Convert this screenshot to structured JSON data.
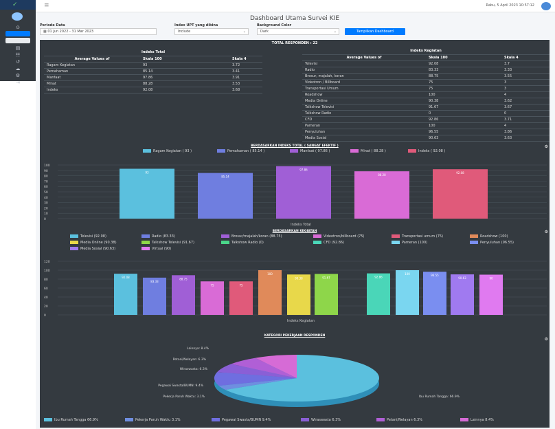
{
  "header": {
    "datetime": "Rabu, 5 April 2023 10:57:12"
  },
  "title": "Dashboard Utama Survei KIE",
  "filters": {
    "periode_label": "Periode Data",
    "periode_value": "01 Jun 2022 - 31 Mar 2023",
    "upt_label": "Index UPT yang dibina",
    "upt_value": "Include",
    "bg_label": "Background Color",
    "bg_value": "Dark",
    "show_button": "Tampilkan Dashboard"
  },
  "total_responden": "TOTAL RESPONDEN : 22",
  "indeks_total": {
    "title": "Indeks Total",
    "headers": [
      "Average Values of",
      "Skala 100",
      "Skala 4"
    ],
    "rows": [
      [
        "Ragam Kegiatan",
        "93",
        "3.72"
      ],
      [
        "Pemahaman",
        "85.14",
        "3.41"
      ],
      [
        "Manfaat",
        "97.86",
        "3.91"
      ],
      [
        "Minat",
        "88.28",
        "3.53"
      ],
      [
        "Indeks",
        "92.08",
        "3.68"
      ]
    ]
  },
  "indeks_kegiatan": {
    "title": "Indeks Kegiatan",
    "headers": [
      "Average Values of",
      "Skala 100",
      "Skala 4"
    ],
    "rows": [
      [
        "Televisi",
        "92.08",
        "3.7"
      ],
      [
        "Radio",
        "83.33",
        "3.33"
      ],
      [
        "Brosur, majalah, koran",
        "88.75",
        "3.55"
      ],
      [
        "Videotron / Billboard",
        "75",
        "3"
      ],
      [
        "Transportasi Umum",
        "75",
        "3"
      ],
      [
        "Roadshow",
        "100",
        "4"
      ],
      [
        "Media Online",
        "90.38",
        "3.62"
      ],
      [
        "Talkshow Televisi",
        "91.67",
        "3.67"
      ],
      [
        "Talkshow Radio",
        "0",
        "0"
      ],
      [
        "CFD",
        "92.86",
        "3.71"
      ],
      [
        "Pameran",
        "100",
        "4"
      ],
      [
        "Penyuluhan",
        "96.55",
        "3.86"
      ],
      [
        "Media Sosial",
        "90.63",
        "3.63"
      ],
      [
        "Virtual",
        "90",
        "3.6"
      ]
    ]
  },
  "chart_total": {
    "title": "BERDASARKAN INDEKS TOTAL ( SANGAT EFEKTIF )",
    "xlabel": "Indeks Total",
    "chart_data": {
      "type": "bar",
      "categories": [
        "Ragam Kegiatan",
        "Pemahaman",
        "Manfaat",
        "Minat",
        "Indeks"
      ],
      "values": [
        93,
        85.14,
        97.86,
        88.28,
        92.08
      ],
      "legend": [
        "Ragam Kegiatan ( 93 )",
        "Pemahaman ( 85.14 )",
        "Manfaat ( 97.86 )",
        "Minat ( 88.28 )",
        "Indeks ( 92.08 )"
      ],
      "colors": [
        "#5bc0de",
        "#6f7ee0",
        "#a05fd6",
        "#d96bd6",
        "#e05a7a"
      ],
      "ylim": [
        0,
        100
      ],
      "yticks": [
        0,
        10,
        20,
        30,
        40,
        50,
        60,
        70,
        80,
        90,
        100
      ]
    }
  },
  "chart_kegiatan": {
    "title": "BERDASARKAN KEGIATAN",
    "xlabel": "Indeks Kegiatan",
    "chart_data": {
      "type": "bar",
      "categories": [
        "Televisi",
        "Radio",
        "Brosur/majalah/koran",
        "Videotron/billboard",
        "Transportasi umum",
        "Roadshow",
        "Media Online",
        "Talkshow Televisi",
        "Talkshow Radio",
        "CFD",
        "Pameran",
        "Penyuluhan",
        "Media Sosial",
        "Virtual"
      ],
      "values": [
        92.08,
        83.33,
        88.75,
        75,
        75,
        100,
        90.38,
        91.67,
        0,
        92.86,
        100,
        96.55,
        90.63,
        90
      ],
      "labels": [
        "92.08",
        "83.33",
        "88.75",
        "75",
        "75",
        "100",
        "90.38",
        "91.67",
        "",
        "92.86",
        "100",
        "96.55",
        "90.63",
        "90"
      ],
      "legend": [
        "Televisi (92.08)",
        "Radio (83.33)",
        "Brosur/majalah/koran (88.75)",
        "Videotron/billboard (75)",
        "Transportasi umum (75)",
        "Roadshow (100)",
        "Media Online (90.38)",
        "Talkshow Televisi (91.67)",
        "Talkshow Radio (0)",
        "CFD (92.86)",
        "Pameran (100)",
        "Penyuluhan (96.55)",
        "Media Sosial (90.63)",
        "Virtual (90)"
      ],
      "colors": [
        "#5bc0de",
        "#6f7ee0",
        "#a05fd6",
        "#d96bd6",
        "#e05a7a",
        "#e08a5a",
        "#e8d84a",
        "#8ed64a",
        "#4ad68a",
        "#4ad6b8",
        "#7ad6f0",
        "#7a8ef0",
        "#a07af0",
        "#e07af0"
      ],
      "ylim": [
        0,
        120
      ],
      "yticks": [
        0,
        20,
        40,
        60,
        80,
        100,
        120
      ]
    }
  },
  "chart_pekerjaan": {
    "title": "KATEGORI PEKERJAAN RESPONDEN",
    "chart_data": {
      "type": "pie",
      "categories": [
        "Ibu Rumah Tangga",
        "Pekerja Paruh Waktu",
        "Pegawai Swasta/BUMN",
        "Wiraswasta",
        "Petani/Nelayan",
        "Lainnya"
      ],
      "values": [
        66.9,
        3.1,
        9.4,
        6.3,
        6.3,
        8.4
      ],
      "labels": [
        "Ibu Rumah Tangga: 66.9%",
        "Pekerja Paruh Waktu: 3.1%",
        "Pegawai Swasta/BUMN: 9.4%",
        "Wiraswasta: 6.3%",
        "Petani/Nelayan: 6.3%",
        "Lainnya: 8.4%"
      ],
      "legend_names": [
        "Ibu Rumah Tangga",
        "Pekerja Paruh Waktu",
        "Pegawai Swasta/BUMN",
        "Wiraswasta",
        "Petani/Nelayan",
        "Lainnya"
      ],
      "legend_values": [
        "66.9%",
        "3.1%",
        "9.4%",
        "6.3%",
        "6.3%",
        "8.4%"
      ],
      "colors": [
        "#5bc0de",
        "#6f8ee0",
        "#6f6ee0",
        "#8a5fd6",
        "#b05fd6",
        "#d66bd6"
      ]
    }
  }
}
